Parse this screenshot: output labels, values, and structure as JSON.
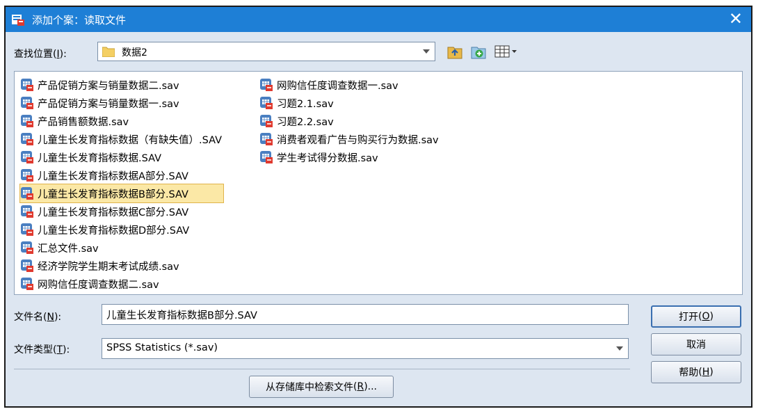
{
  "window": {
    "title": "添加个案：读取文件"
  },
  "lookin": {
    "label": "查找位置",
    "mnemonic": "I",
    "value": "数据2"
  },
  "files": {
    "col1": [
      "产品促销方案与销量数据二.sav",
      "产品促销方案与销量数据一.sav",
      "产品销售额数据.sav",
      "儿童生长发育指标数据（有缺失值）.SAV",
      "儿童生长发育指标数据.SAV",
      "儿童生长发育指标数据A部分.SAV",
      "儿童生长发育指标数据B部分.SAV",
      "儿童生长发育指标数据C部分.SAV",
      "儿童生长发育指标数据D部分.SAV",
      "汇总文件.sav",
      "经济学院学生期末考试成绩.sav",
      "网购信任度调查数据二.sav"
    ],
    "col2": [
      "网购信任度调查数据一.sav",
      "习题2.1.sav",
      "习题2.2.sav",
      "消费者观看广告与购买行为数据.sav",
      "学生考试得分数据.sav"
    ],
    "selected": "儿童生长发育指标数据B部分.SAV"
  },
  "filename": {
    "label": "文件名",
    "mnemonic": "N",
    "value": "儿童生长发育指标数据B部分.SAV"
  },
  "filetype": {
    "label": "文件类型",
    "mnemonic": "T",
    "value": "SPSS Statistics (*.sav)"
  },
  "buttons": {
    "open": {
      "label": "打开",
      "mnemonic": "O"
    },
    "cancel": {
      "label": "取消"
    },
    "help": {
      "label": "帮助",
      "mnemonic": "H"
    },
    "repo": {
      "label": "从存储库中检索文件",
      "mnemonic": "R",
      "suffix": "..."
    }
  },
  "colors": {
    "titlebar": "#1e7fd6",
    "dialog_bg": "#dde6f1",
    "selection": "#fbe8a6"
  }
}
